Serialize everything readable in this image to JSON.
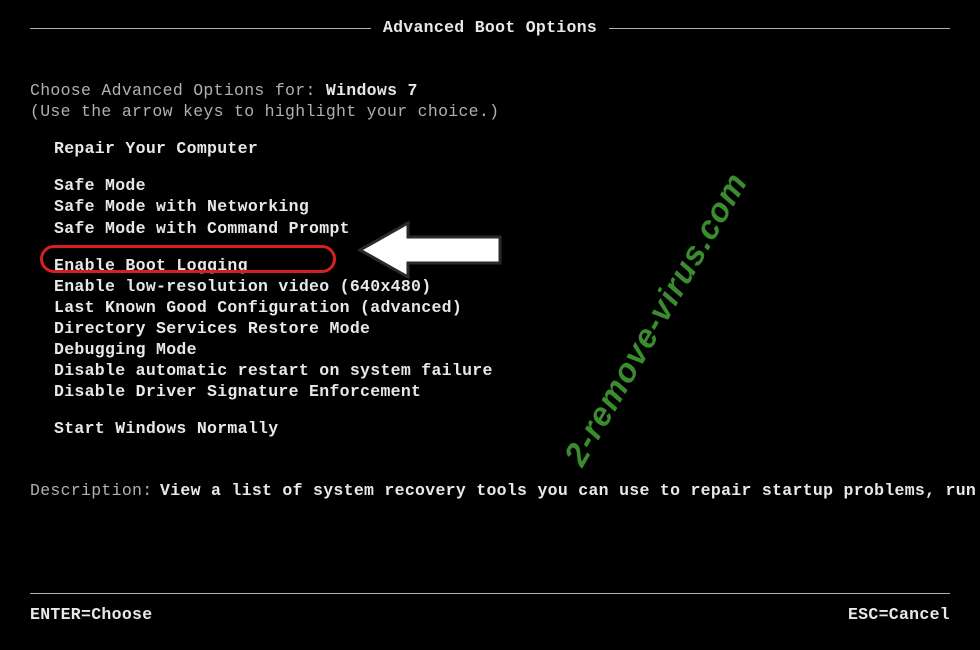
{
  "title": "Advanced Boot Options",
  "prompt_prefix": "Choose Advanced Options for: ",
  "os_name": "Windows 7",
  "hint": "(Use the arrow keys to highlight your choice.)",
  "menu": {
    "repair": "Repair Your Computer",
    "safe": "Safe Mode",
    "safe_net": "Safe Mode with Networking",
    "safe_cmd": "Safe Mode with Command Prompt",
    "boot_log": "Enable Boot Logging",
    "low_res": "Enable low-resolution video (640x480)",
    "lkgc": "Last Known Good Configuration (advanced)",
    "dsrm": "Directory Services Restore Mode",
    "debug": "Debugging Mode",
    "no_auto_restart": "Disable automatic restart on system failure",
    "no_drv_sig": "Disable Driver Signature Enforcement",
    "normal": "Start Windows Normally"
  },
  "description": {
    "label": "Description:",
    "text": "View a list of system recovery tools you can use to repair startup problems, run diagnostics, or restore your system."
  },
  "footer": {
    "enter": "ENTER=Choose",
    "esc": "ESC=Cancel"
  },
  "watermark": "2-remove-virus.com"
}
